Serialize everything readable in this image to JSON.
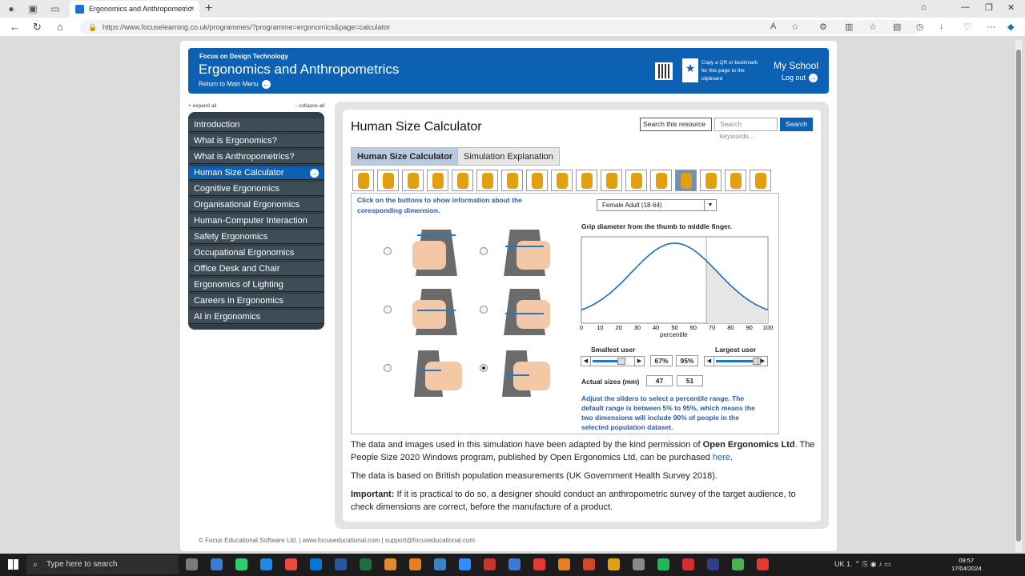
{
  "browser": {
    "tab_title": "Ergonomics and Anthropometric",
    "url": "https://www.focuselearning.co.uk/programmes/?programme=ergonomics&page=calculator"
  },
  "header": {
    "kicker": "Focus on Design Technology",
    "title": "Ergonomics and Anthropometrics",
    "return": "Return to Main Menu",
    "copy_text": "Copy a QR or bookmark for this page to the clipboard",
    "school": "My School",
    "logout": "Log out"
  },
  "sidebar": {
    "expand": "+ expand all",
    "collapse": "- collapse all",
    "items": [
      {
        "label": "Introduction"
      },
      {
        "label": "What is Ergonomics?"
      },
      {
        "label": "What is Anthropometrics?"
      },
      {
        "label": "Human Size Calculator"
      },
      {
        "label": "Cognitive Ergonomics"
      },
      {
        "label": "Organisational Ergonomics"
      },
      {
        "label": "Human-Computer Interaction"
      },
      {
        "label": "Safety Ergonomics"
      },
      {
        "label": "Occupational Ergonomics"
      },
      {
        "label": "Office Desk and Chair"
      },
      {
        "label": "Ergonomics of Lighting"
      },
      {
        "label": "Careers in Ergonomics"
      },
      {
        "label": "AI in Ergonomics"
      }
    ]
  },
  "main": {
    "title": "Human Size Calculator",
    "search_scope": "Search this resource",
    "search_placeholder": "Search keywords...",
    "search_button": "Search",
    "tabs": [
      {
        "label": "Human Size Calculator"
      },
      {
        "label": "Simulation Explanation"
      }
    ],
    "hint": "Click on the buttons to show information about the coresponding dimension.",
    "population": "Female Adult (18-64)",
    "description": "Grip diameter from the thumb to middle finger.",
    "xlabel": "percentile",
    "x_ticks": [
      "0",
      "10",
      "20",
      "30",
      "40",
      "50",
      "60",
      "70",
      "80",
      "90",
      "100"
    ],
    "smallest_label": "Smallest user",
    "largest_label": "Largest user",
    "smallest_pct": "67%",
    "largest_pct": "95%",
    "actual_label": "Actual sizes (mm)",
    "actual_small": "47",
    "actual_large": "51",
    "adjust_note": "Adjust the sliders to select a percentile range. The default range is between 5%  to 95%, which means the two dimensions will include 90% of people in the selected population dataset.",
    "para1_a": "The data and images used in this simulation have been adapted by the kind permission of ",
    "para1_b": "Open Ergonomics Ltd",
    "para1_c": ". The People Size 2020 Windows program, published by Open Ergonomics Ltd, can be purchased ",
    "para1_link": "here",
    "para2": "The data is based on British population measurements (UK Government Health Survey 2018).",
    "para3_a": "Important:",
    "para3_b": " If it is practical to do so, a designer should conduct an anthropometric survey of the target audience, to check dimensions are correct, before the manufacture of a product."
  },
  "footer": {
    "text": "© Focus Educational Software Ltd.   |   www.focuseducational.com   |   support@focuseducational.com"
  },
  "taskbar": {
    "search": "Type here to search",
    "lang": "UK 1.",
    "time": "09:57",
    "date": "17/04/2024"
  },
  "slider_state": {
    "smallest": 0.67,
    "largest": 0.95
  }
}
